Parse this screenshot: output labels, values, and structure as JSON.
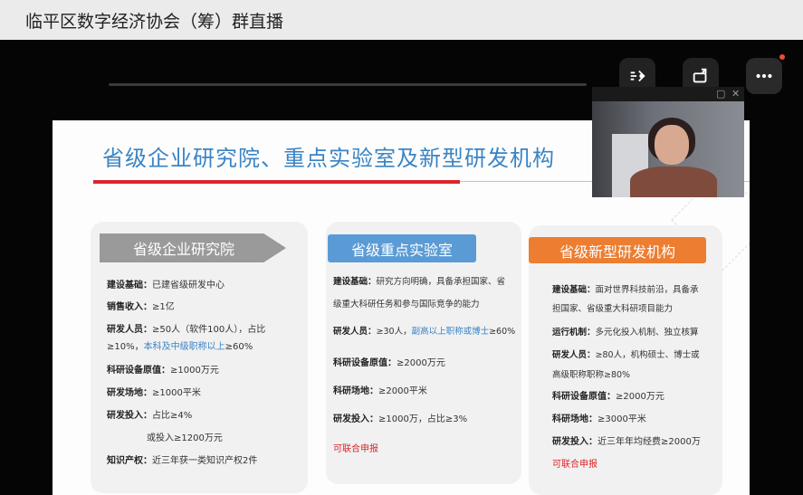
{
  "window": {
    "title": "临平区数字经济协会（筹）群直播"
  },
  "controls": {
    "items": [
      {
        "name": "audio-sync-icon"
      },
      {
        "name": "rotate-screen-icon"
      },
      {
        "name": "more-icon"
      }
    ]
  },
  "slide": {
    "title": "省级企业研究院、重点实验室及新型研发机构",
    "cards": [
      {
        "header": "省级企业研究院",
        "color": "#9a9a9a",
        "rows": [
          {
            "label": "建设基础：",
            "text": "已建省级研发中心"
          },
          {
            "label": "销售收入：",
            "text": "≥1亿"
          },
          {
            "label": "研发人员：",
            "text": "≥50人（软件100人），占比"
          },
          {
            "label": "",
            "text": "≥10%，",
            "highlight": "本科及中级职称以上",
            "suffix": "≥60%"
          },
          {
            "label": "科研设备原值：",
            "text": "≥1000万元"
          },
          {
            "label": "研发场地：",
            "text": "≥1000平米"
          },
          {
            "label": "研发投入：",
            "text": "占比≥4%"
          },
          {
            "label": "",
            "text": "或投入≥1200万元"
          },
          {
            "label": "知识产权：",
            "text": "近三年获一类知识产权2件"
          }
        ]
      },
      {
        "header": "省级重点实验室",
        "color": "#5b9bd5",
        "rows": [
          {
            "label": "建设基础：",
            "text": "研究方向明确，具备承担国家、省"
          },
          {
            "label": "",
            "text": "级重大科研任务和参与国际竞争的能力"
          },
          {
            "label": "研发人员：",
            "text": "≥30人，",
            "highlight": "副高以上职称或博士",
            "suffix": "≥60%"
          },
          {
            "label": "科研设备原值：",
            "text": "≥2000万元"
          },
          {
            "label": "科研场地：",
            "text": "≥2000平米"
          },
          {
            "label": "研发投入：",
            "text": "≥1000万，占比≥3%"
          },
          {
            "label": "",
            "text": "可联合申报",
            "red": true
          }
        ]
      },
      {
        "header": "省级新型研发机构",
        "color": "#ed7d31",
        "rows": [
          {
            "label": "建设基础：",
            "text": "面对世界科技前沿，具备承"
          },
          {
            "label": "",
            "text": "担国家、省级重大科研项目能力"
          },
          {
            "label": "运行机制：",
            "text": "多元化投入机制、独立核算"
          },
          {
            "label": "研发人员：",
            "text": "≥80人，机构硕士、博士或"
          },
          {
            "label": "",
            "text": "高级职称职称≥80%"
          },
          {
            "label": "科研设备原值：",
            "text": "≥2000万元"
          },
          {
            "label": "科研场地：",
            "text": "≥3000平米"
          },
          {
            "label": "研发投入：",
            "text": "近三年年均经费≥2000万"
          },
          {
            "label": "",
            "text": "可联合申报",
            "red": true
          }
        ]
      }
    ]
  },
  "webcam": {
    "restore_glyph": "▢",
    "close_glyph": "✕"
  }
}
